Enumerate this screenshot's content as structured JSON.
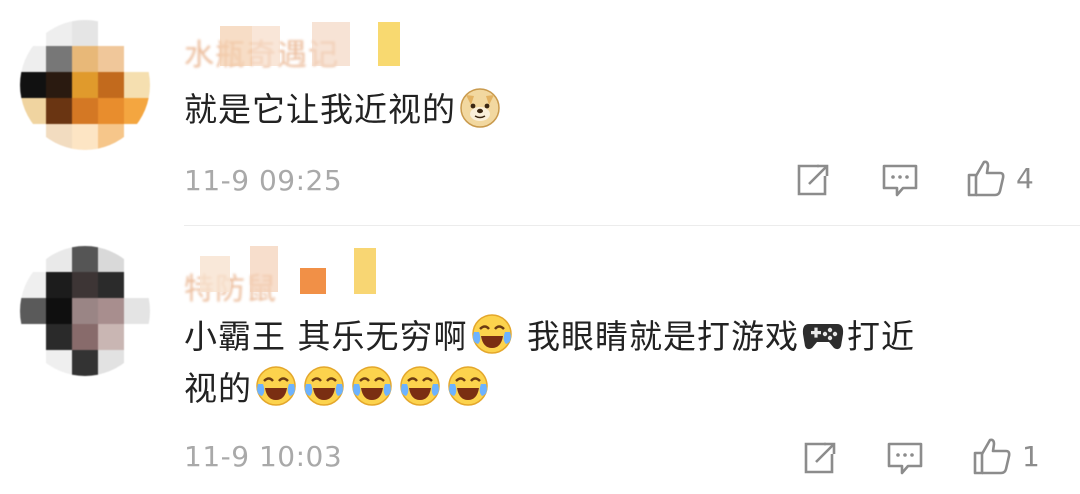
{
  "comments": [
    {
      "username": "水瓶奇遇记",
      "text_lines": [
        [
          {
            "t": "就是它让我近视的"
          },
          {
            "emoji": "doge-emoji"
          }
        ]
      ],
      "timestamp": "11-9 09:25",
      "likes": "4"
    },
    {
      "username": "特防鼠",
      "text_lines": [
        [
          {
            "t": "小霸王 其乐无穷啊"
          },
          {
            "emoji": "laugh-cry-emoji"
          },
          {
            "t": " 我眼睛就是打游戏"
          },
          {
            "emoji": "gamepad-emoji"
          },
          {
            "t": "打近"
          }
        ],
        [
          {
            "t": "视的"
          },
          {
            "emoji": "laugh-cry-emoji"
          },
          {
            "emoji": "laugh-cry-emoji"
          },
          {
            "emoji": "laugh-cry-emoji"
          },
          {
            "emoji": "laugh-cry-emoji"
          },
          {
            "emoji": "laugh-cry-emoji"
          }
        ]
      ],
      "timestamp": "11-9 10:03",
      "likes": "1"
    }
  ],
  "icons": {
    "share": "share-icon",
    "comment": "comment-icon",
    "like": "thumbs-up-icon"
  },
  "colors": {
    "username": "#e8b089",
    "text": "#222222",
    "meta": "#a9a9a9"
  }
}
